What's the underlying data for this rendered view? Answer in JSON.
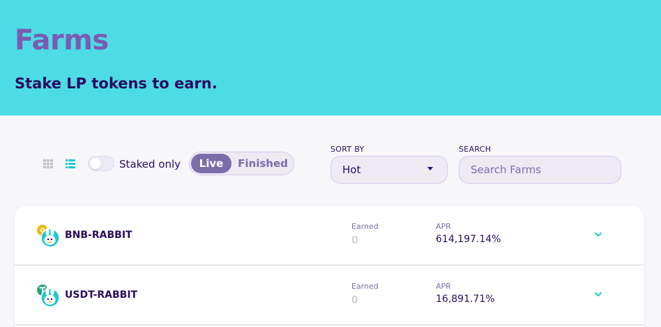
{
  "header": {
    "title": "Farms",
    "subtitle": "Stake LP tokens to earn."
  },
  "controls": {
    "view_icons": [
      "grid-view-icon",
      "list-view-icon"
    ],
    "active_view": "list",
    "staked_only_label": "Staked only",
    "staked_only_checked": false,
    "segments": [
      "Live",
      "Finished"
    ],
    "active_segment": "Live",
    "sort_label": "SORT BY",
    "sort_value": "Hot",
    "search_label": "SEARCH",
    "search_placeholder": "Search Farms",
    "search_value": ""
  },
  "farms": [
    {
      "name": "BNB-RABBIT",
      "earned_label": "Earned",
      "earned": "0",
      "apr_label": "APR",
      "apr": "614,197.14%",
      "token_icons": [
        "bnb-icon",
        "rabbit-icon"
      ]
    },
    {
      "name": "USDT-RABBIT",
      "earned_label": "Earned",
      "earned": "0",
      "apr_label": "APR",
      "apr": "16,891.71%",
      "token_icons": [
        "usdt-icon",
        "rabbit-icon"
      ]
    }
  ],
  "colors": {
    "hero_bg": "#4ddbe6",
    "title": "#7a5bb1",
    "text": "#280d5f",
    "secondary": "#7a6eaa",
    "accent": "#1fc7d4",
    "bnb": "#f0b90b",
    "usdt": "#26a17b"
  }
}
